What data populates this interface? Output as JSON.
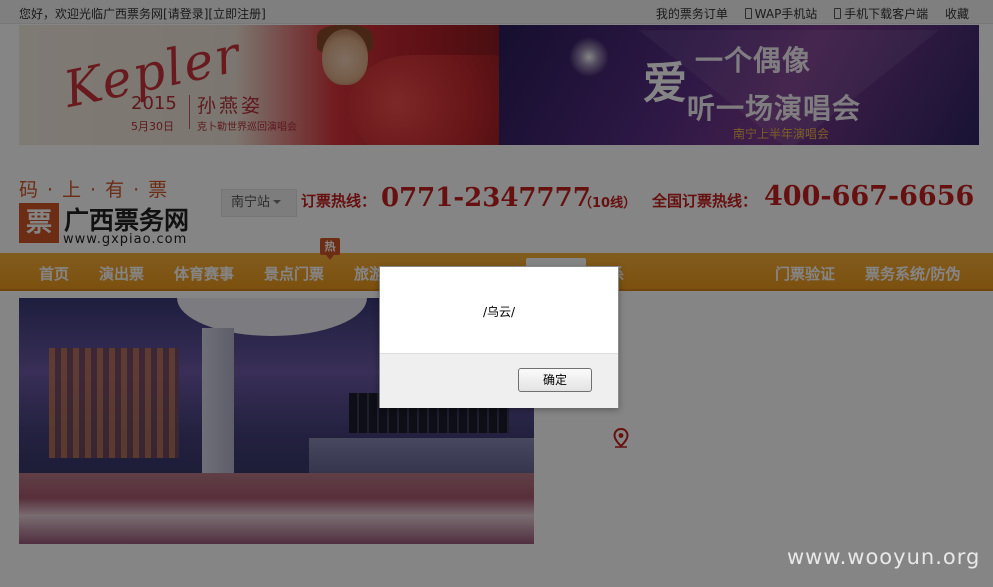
{
  "topbar": {
    "welcome": "您好，欢迎光临广西票务网",
    "login": "[请登录]",
    "register": "[立即注册]",
    "links": [
      "我的票务订单",
      "WAP手机站",
      "手机下载客户端",
      "收藏"
    ]
  },
  "banner_left": {
    "script_title": "Kepler",
    "year": "2015",
    "date": "5月30日",
    "artist": "孙燕姿",
    "tour": "克卜勒世界巡回演唱会"
  },
  "banner_right": {
    "big1": "爱",
    "big2": "一个偶像",
    "big3": "听一场演唱会",
    "small": "南宁上半年演唱会"
  },
  "header": {
    "slogan": "码·上·有·票",
    "logo_mark": "票",
    "logo_text": "广西票务网",
    "logo_url": "www.gxpiao.com",
    "city": "南宁站",
    "hotline_label": "订票热线：",
    "hotline_number": "0771-2347777",
    "hotline_note": "（10线）",
    "national_label": "全国订票热线：",
    "national_number": "400-667-6656"
  },
  "nav": {
    "items": [
      "首页",
      "演出票",
      "体育赛事",
      "景点门票",
      "旅游",
      "秒杀",
      "门票验证",
      "票务系统/防伪"
    ],
    "hot_tag": "热"
  },
  "dialog": {
    "message": "/乌云/",
    "ok_label": "确定"
  },
  "watermark": "www.wooyun.org",
  "colors": {
    "accent_red": "#c41f1f",
    "nav_orange": "#ee9a1e",
    "logo_orange": "#d1562a"
  }
}
